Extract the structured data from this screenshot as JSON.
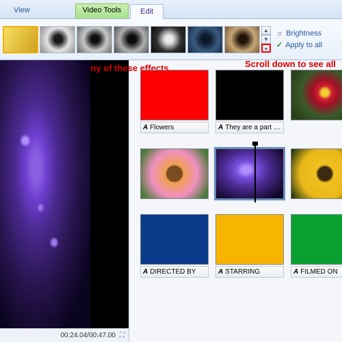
{
  "ribbon": {
    "group_label": "Video Tools",
    "tabs": {
      "view": "View",
      "edit": "Edit"
    },
    "brightness_label": "Brightness",
    "apply_all_label": "Apply to all"
  },
  "annotations": {
    "effects_hint": "Choose any of these effects",
    "scroll_hint": "Scroll down to see all styles"
  },
  "preview": {
    "time_display": "00:24.04/00:47.00"
  },
  "clips": {
    "row1": [
      {
        "label": "Flowers"
      },
      {
        "label": "They are a part of.."
      },
      {
        "label": ""
      }
    ],
    "row3": [
      {
        "label": "DIRECTED BY"
      },
      {
        "label": "STARRING"
      },
      {
        "label": "FILMED ON"
      }
    ]
  },
  "label_prefix": "A"
}
